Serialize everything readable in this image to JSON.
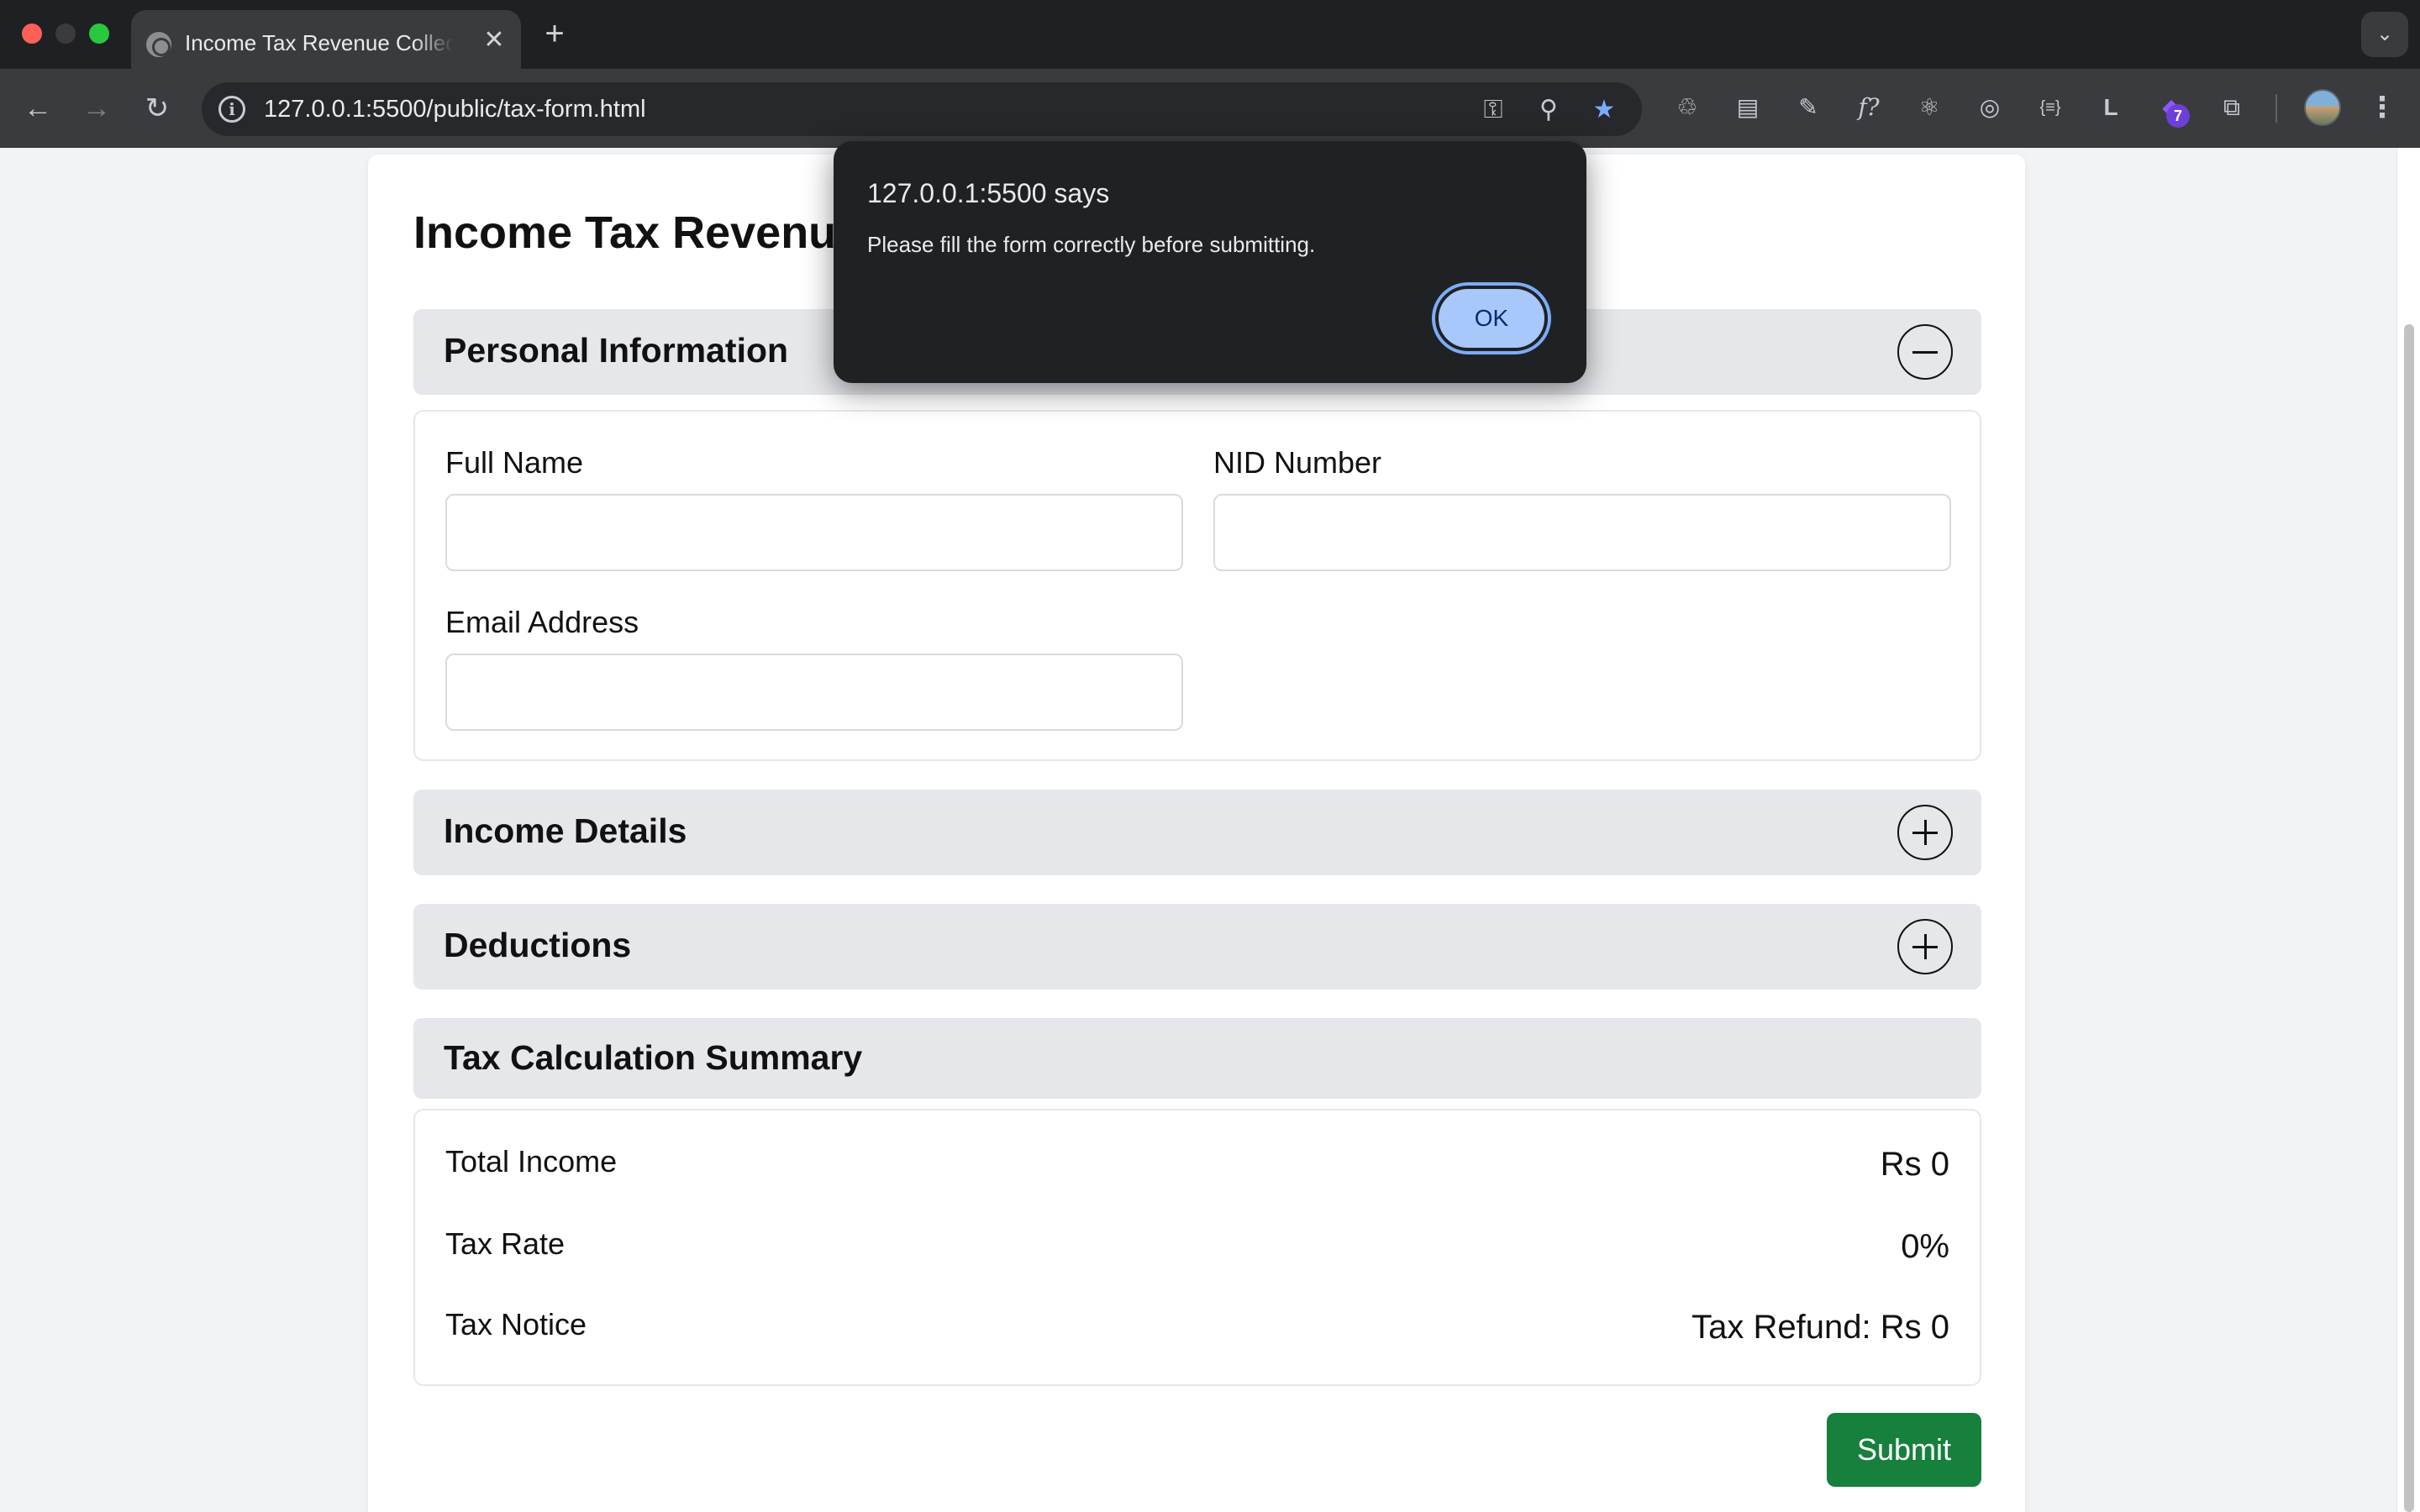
{
  "browser": {
    "tab_title": "Income Tax Revenue Collection",
    "tab_close": "✕",
    "new_tab": "+",
    "tab_menu": "⌄",
    "url": "127.0.0.1:5500/public/tax-form.html",
    "extension_badge_count": "7",
    "icons": [
      "back-icon",
      "forward-icon",
      "reload-icon",
      "site-info-icon",
      "password-key-icon",
      "zoom-icon",
      "bookmark-star-icon",
      "extensions-puzzle-icon",
      "profile-avatar",
      "more-menu-icon"
    ]
  },
  "page": {
    "title": "Income Tax Revenue Collection",
    "sections": {
      "personal": {
        "title": "Personal Information",
        "state": "expanded",
        "fields": {
          "full_name_label": "Full Name",
          "full_name_value": "",
          "nid_label": "NID Number",
          "nid_value": "",
          "email_label": "Email Address",
          "email_value": ""
        }
      },
      "income": {
        "title": "Income Details",
        "state": "collapsed"
      },
      "deductions": {
        "title": "Deductions",
        "state": "collapsed"
      },
      "summary": {
        "title": "Tax Calculation Summary",
        "rows": {
          "total_income_label": "Total Income",
          "total_income_value": "Rs 0",
          "tax_rate_label": "Tax Rate",
          "tax_rate_value": "0%",
          "tax_notice_label": "Tax Notice",
          "tax_notice_value": "Tax Refund: Rs 0"
        }
      }
    },
    "submit_label": "Submit"
  },
  "dialog": {
    "title": "127.0.0.1:5500 says",
    "message": "Please fill the form correctly before submitting.",
    "ok_label": "OK"
  },
  "colors": {
    "submit_green": "#16803c",
    "section_header_bg": "#e5e7eb",
    "dialog_bg": "#202124",
    "dialog_ok_bg": "#a8c7fa"
  }
}
